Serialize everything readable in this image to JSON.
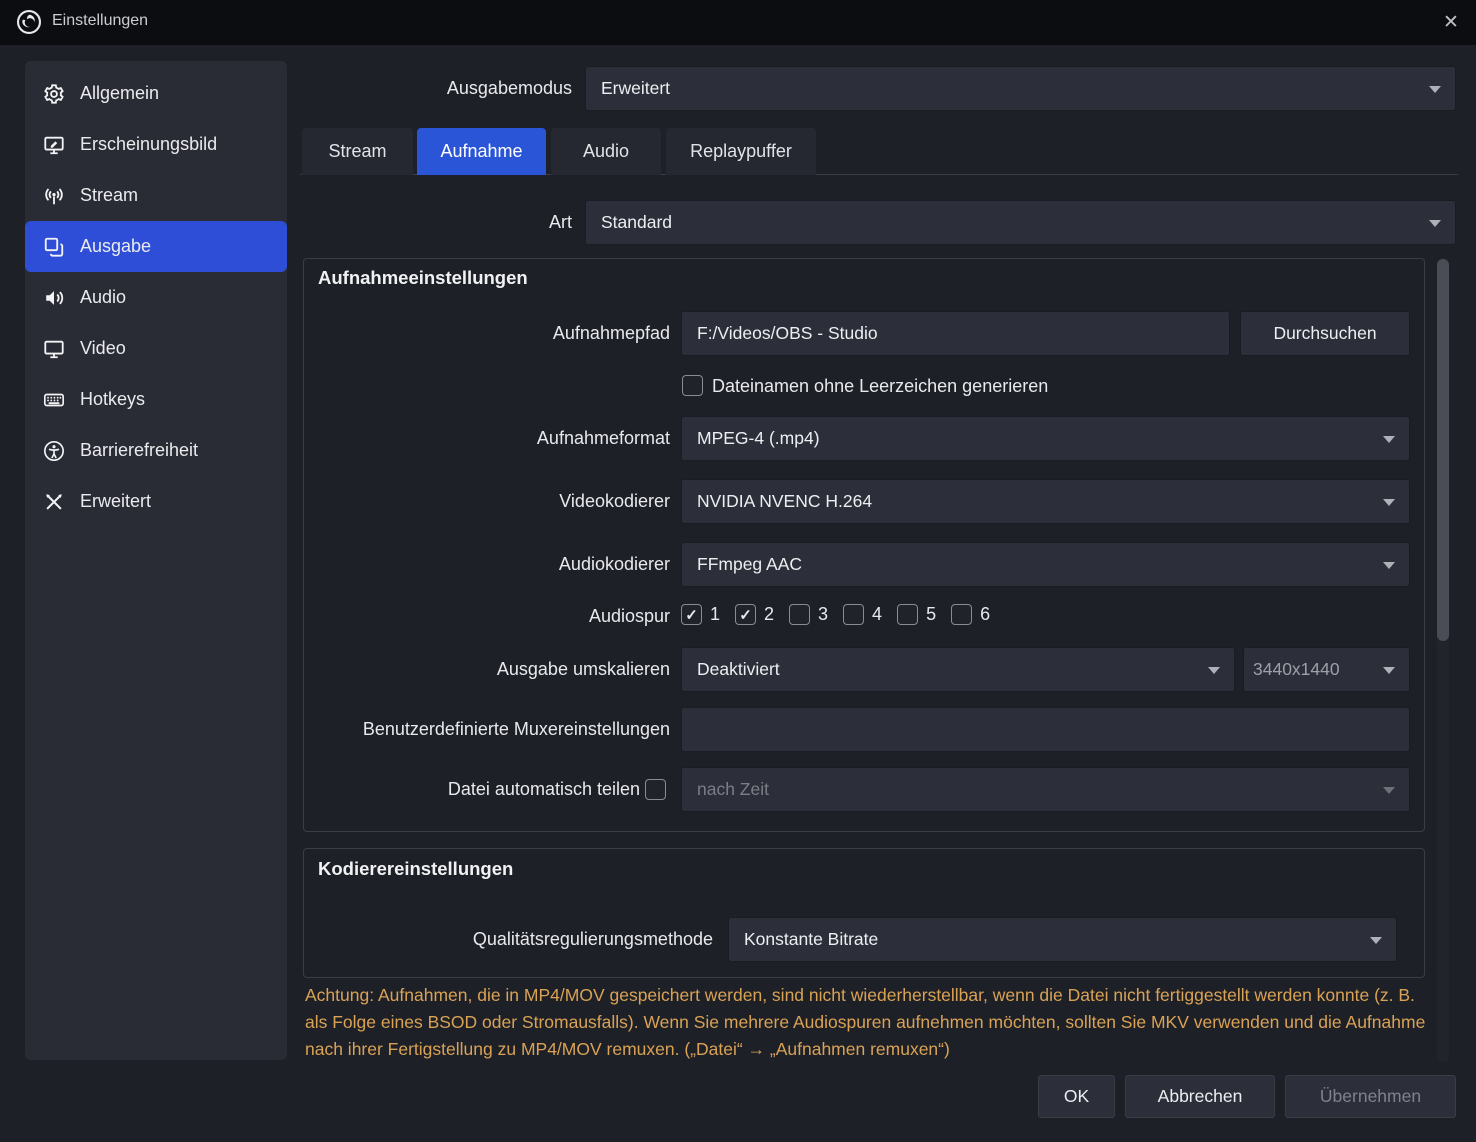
{
  "window": {
    "title": "Einstellungen",
    "close_glyph": "✕"
  },
  "sidebar": {
    "items": [
      {
        "label": "Allgemein",
        "icon": "gear-icon",
        "active": false
      },
      {
        "label": "Erscheinungsbild",
        "icon": "appearance-icon",
        "active": false
      },
      {
        "label": "Stream",
        "icon": "broadcast-icon",
        "active": false
      },
      {
        "label": "Ausgabe",
        "icon": "output-icon",
        "active": true
      },
      {
        "label": "Audio",
        "icon": "speaker-icon",
        "active": false
      },
      {
        "label": "Video",
        "icon": "monitor-icon",
        "active": false
      },
      {
        "label": "Hotkeys",
        "icon": "keyboard-icon",
        "active": false
      },
      {
        "label": "Barrierefreiheit",
        "icon": "accessibility-icon",
        "active": false
      },
      {
        "label": "Erweitert",
        "icon": "tools-icon",
        "active": false
      }
    ]
  },
  "output_mode": {
    "label": "Ausgabemodus",
    "value": "Erweitert"
  },
  "tabs": [
    {
      "label": "Stream",
      "active": false
    },
    {
      "label": "Aufnahme",
      "active": true
    },
    {
      "label": "Audio",
      "active": false
    },
    {
      "label": "Replaypuffer",
      "active": false
    }
  ],
  "type": {
    "label": "Art",
    "value": "Standard"
  },
  "recording_group": {
    "title": "Aufnahmeeinstellungen",
    "path": {
      "label": "Aufnahmepfad",
      "value": "F:/Videos/OBS - Studio",
      "browse_label": "Durchsuchen"
    },
    "no_spaces": {
      "label": "Dateinamen ohne Leerzeichen generieren",
      "checked": false
    },
    "format": {
      "label": "Aufnahmeformat",
      "value": "MPEG-4 (.mp4)"
    },
    "video_encoder": {
      "label": "Videokodierer",
      "value": "NVIDIA NVENC H.264"
    },
    "audio_encoder": {
      "label": "Audiokodierer",
      "value": "FFmpeg AAC"
    },
    "audio_tracks": {
      "label": "Audiospur",
      "tracks": [
        {
          "label": "1",
          "checked": true
        },
        {
          "label": "2",
          "checked": true
        },
        {
          "label": "3",
          "checked": false
        },
        {
          "label": "4",
          "checked": false
        },
        {
          "label": "5",
          "checked": false
        },
        {
          "label": "6",
          "checked": false
        }
      ]
    },
    "rescale": {
      "label": "Ausgabe umskalieren",
      "value": "Deaktiviert",
      "resolution": "3440x1440"
    },
    "muxer": {
      "label": "Benutzerdefinierte Muxereinstellungen",
      "value": ""
    },
    "auto_split": {
      "label": "Datei automatisch teilen",
      "checked": false,
      "value": "nach Zeit",
      "enabled": false
    }
  },
  "encoder_group": {
    "title": "Kodierereinstellungen",
    "rate_control": {
      "label": "Qualitätsregulierungsmethode",
      "value": "Konstante Bitrate"
    }
  },
  "warning_text": "Achtung: Aufnahmen, die in MP4/MOV gespeichert werden, sind nicht wiederherstellbar, wenn die Datei nicht fertiggestellt werden konnte (z. B. als Folge eines BSOD oder Stromausfalls). Wenn Sie mehrere Audiospuren aufnehmen möchten, sollten Sie MKV verwenden und die Aufnahme nach ihrer Fertigstellung zu MP4/MOV remuxen. („Datei“ → „Aufnahmen remuxen“)",
  "footer": {
    "ok": "OK",
    "cancel": "Abbrechen",
    "apply": "Übernehmen"
  },
  "colors": {
    "accent": "#2e4ed8",
    "warning": "#d9a254"
  }
}
